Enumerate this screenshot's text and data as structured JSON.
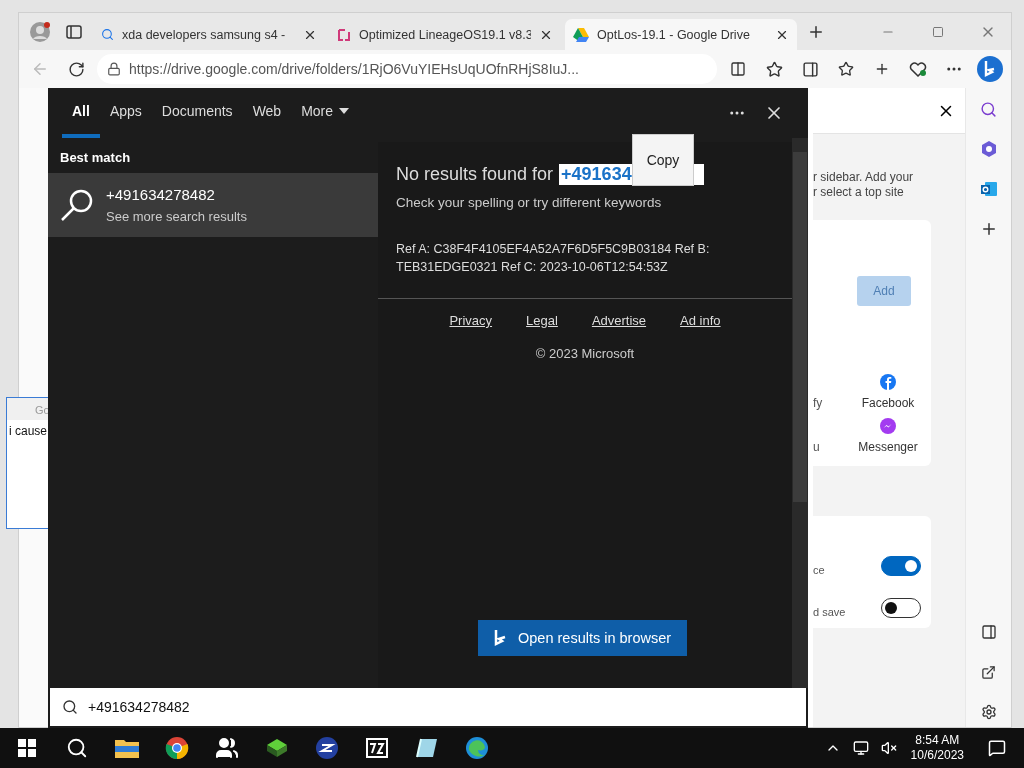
{
  "browser": {
    "tabs": [
      {
        "title": "xda developers samsung s4 -",
        "kind": "search",
        "selected": false
      },
      {
        "title": "Optimized LineageOS19.1 v8.3",
        "kind": "site",
        "selected": false
      },
      {
        "title": "OptLos-19.1 - Google Drive",
        "kind": "drive",
        "selected": true
      }
    ],
    "address": "https://drive.google.com/drive/folders/1RjO6VuYIEHsUqUOfnRHjS8IuJ..."
  },
  "background_window": {
    "title": "Go",
    "text": "i cause"
  },
  "search": {
    "tabs": [
      {
        "label": "All",
        "selected": true
      },
      {
        "label": "Apps",
        "selected": false
      },
      {
        "label": "Documents",
        "selected": false
      },
      {
        "label": "Web",
        "selected": false
      },
      {
        "label": "More",
        "selected": false
      }
    ],
    "best_match_heading": "Best match",
    "best_match": {
      "title": "+491634278482",
      "subtitle": "See more search results",
      "selected": true
    },
    "no_results": {
      "prefix": "No results found for",
      "query_start": "+491634"
    },
    "hint": "Check your spelling or try different keywords",
    "refs": "Ref A: C38F4F4105EF4A52A7F6D5F5C9B03184 Ref B: TEB31EDGE0321 Ref C: 2023-10-06T12:54:53Z",
    "links": [
      "Privacy",
      "Legal",
      "Advertise",
      "Ad info"
    ],
    "copyright": "© 2023 Microsoft",
    "open_button": "Open results in browser",
    "context_menu": {
      "item": "Copy"
    },
    "query": "+491634278482"
  },
  "sidebar_pane": {
    "intro_lines": [
      "r sidebar. Add your",
      "r select a top site"
    ],
    "add_button": {
      "label": "Add",
      "disabled": true
    },
    "sites": [
      {
        "left": "fy",
        "name": "Facebook",
        "kind": "facebook"
      },
      {
        "left": "u",
        "name": "Messenger",
        "kind": "messenger"
      }
    ],
    "toggles": [
      {
        "label": "ce",
        "on": true
      },
      {
        "label": "d save",
        "on": false
      }
    ]
  },
  "taskbar": {
    "time": "8:54 AM",
    "date": "10/6/2023"
  }
}
